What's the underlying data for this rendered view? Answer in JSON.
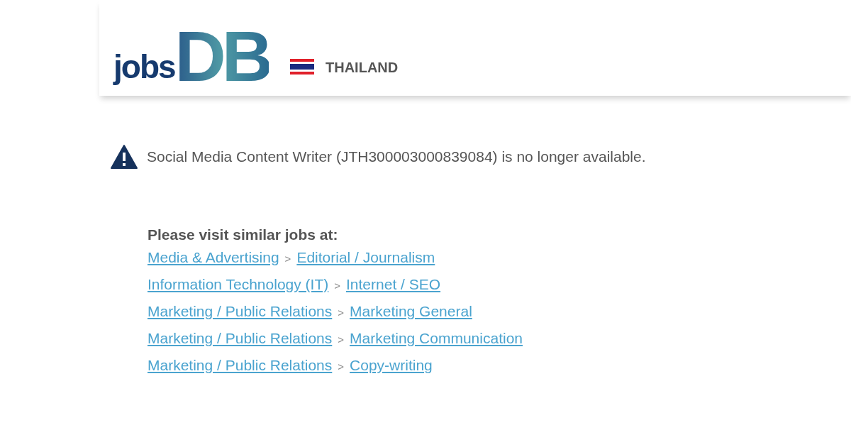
{
  "header": {
    "logo": {
      "word": "jobs",
      "letters": "DB"
    },
    "country": "THAILAND"
  },
  "notice": {
    "message": "Social Media Content Writer (JTH300003000839084) is no longer available."
  },
  "similar": {
    "heading": "Please visit similar jobs at:",
    "separator": ">",
    "links": [
      {
        "category": "Media & Advertising",
        "subcategory": "Editorial / Journalism"
      },
      {
        "category": "Information Technology (IT)",
        "subcategory": "Internet / SEO"
      },
      {
        "category": "Marketing / Public Relations",
        "subcategory": "Marketing General"
      },
      {
        "category": "Marketing / Public Relations",
        "subcategory": "Marketing Communication"
      },
      {
        "category": "Marketing / Public Relations",
        "subcategory": "Copy-writing"
      }
    ]
  }
}
